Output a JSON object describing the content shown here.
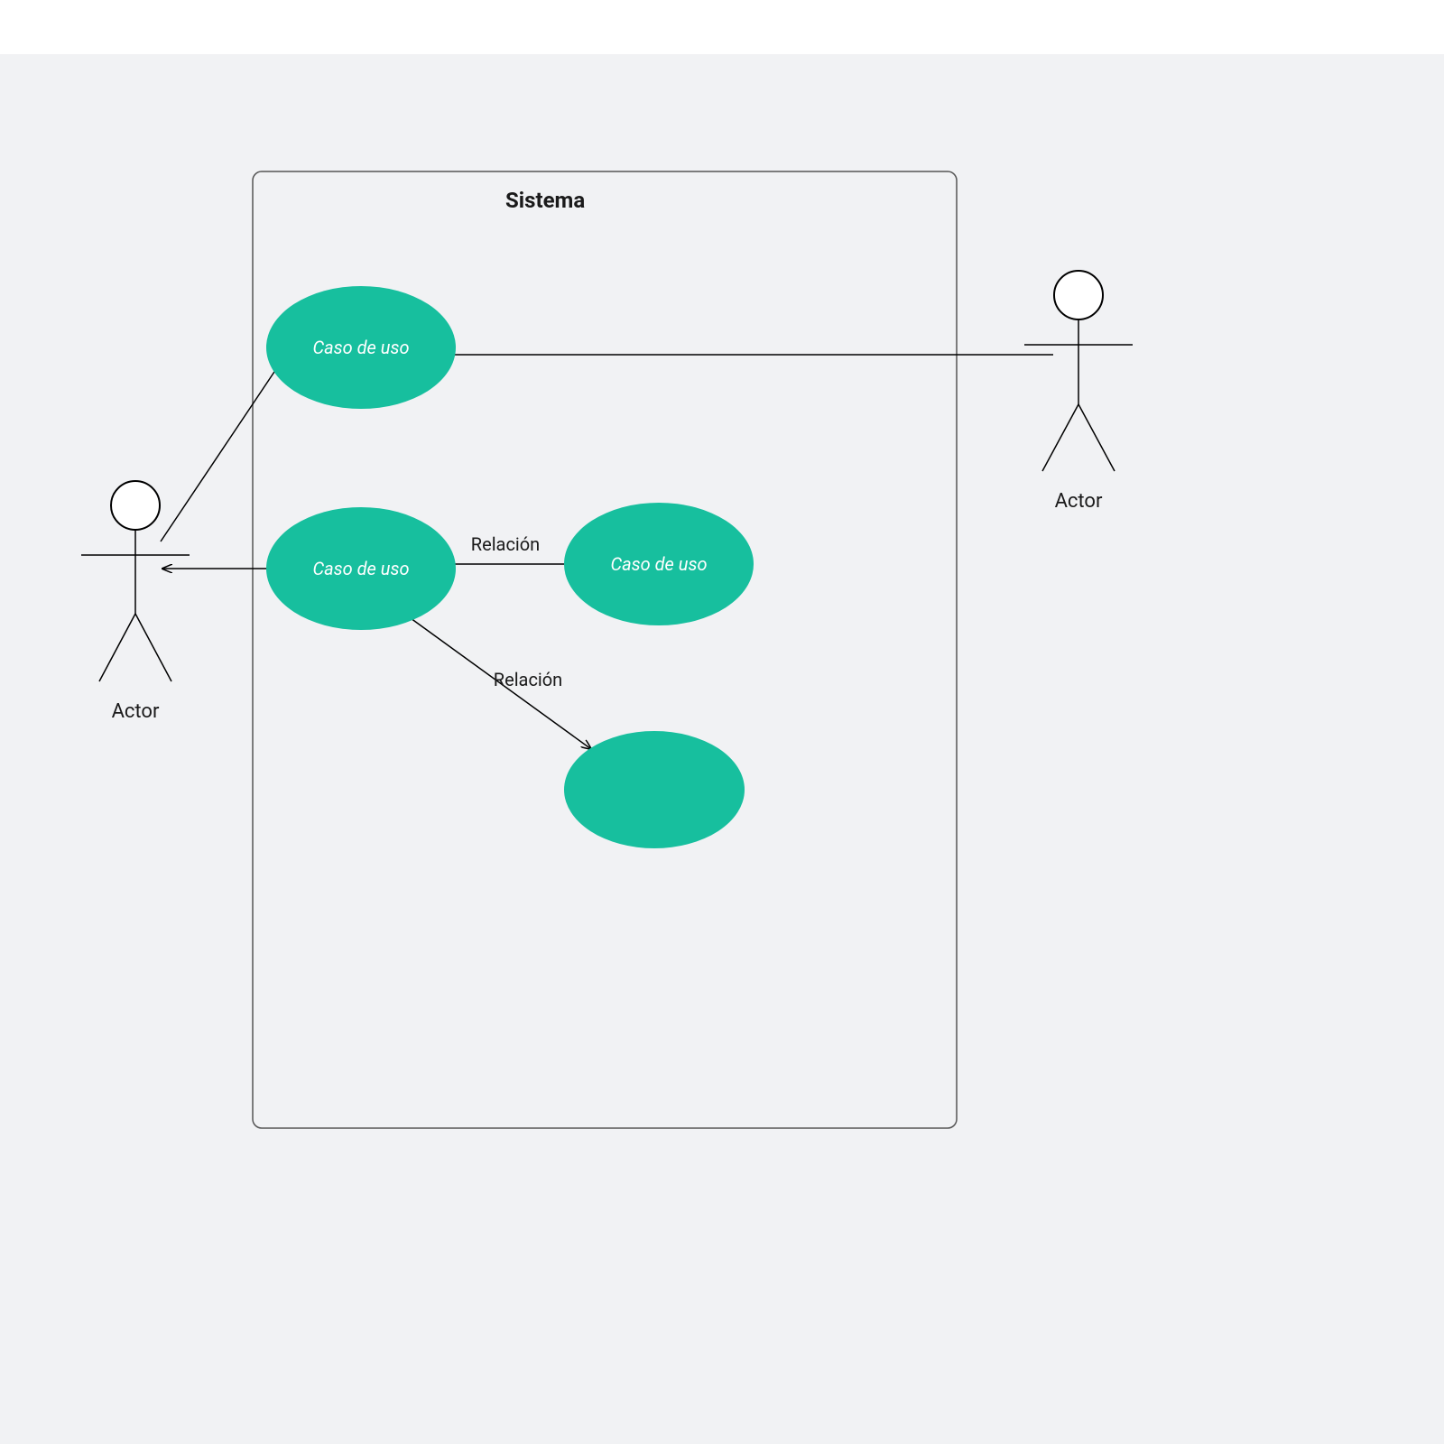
{
  "system": {
    "title": "Sistema"
  },
  "actors": {
    "left": {
      "label": "Actor"
    },
    "right": {
      "label": "Actor"
    }
  },
  "usecases": {
    "uc1": {
      "label": "Caso de uso"
    },
    "uc2": {
      "label": "Caso de uso"
    },
    "uc3": {
      "label": "Caso de uso"
    },
    "uc4": {
      "label": ""
    }
  },
  "relations": {
    "r1": {
      "label": "Relación"
    },
    "r2": {
      "label": "Relación"
    }
  },
  "colors": {
    "usecase_fill": "#17bf9e",
    "canvas_bg": "#f1f2f4"
  }
}
